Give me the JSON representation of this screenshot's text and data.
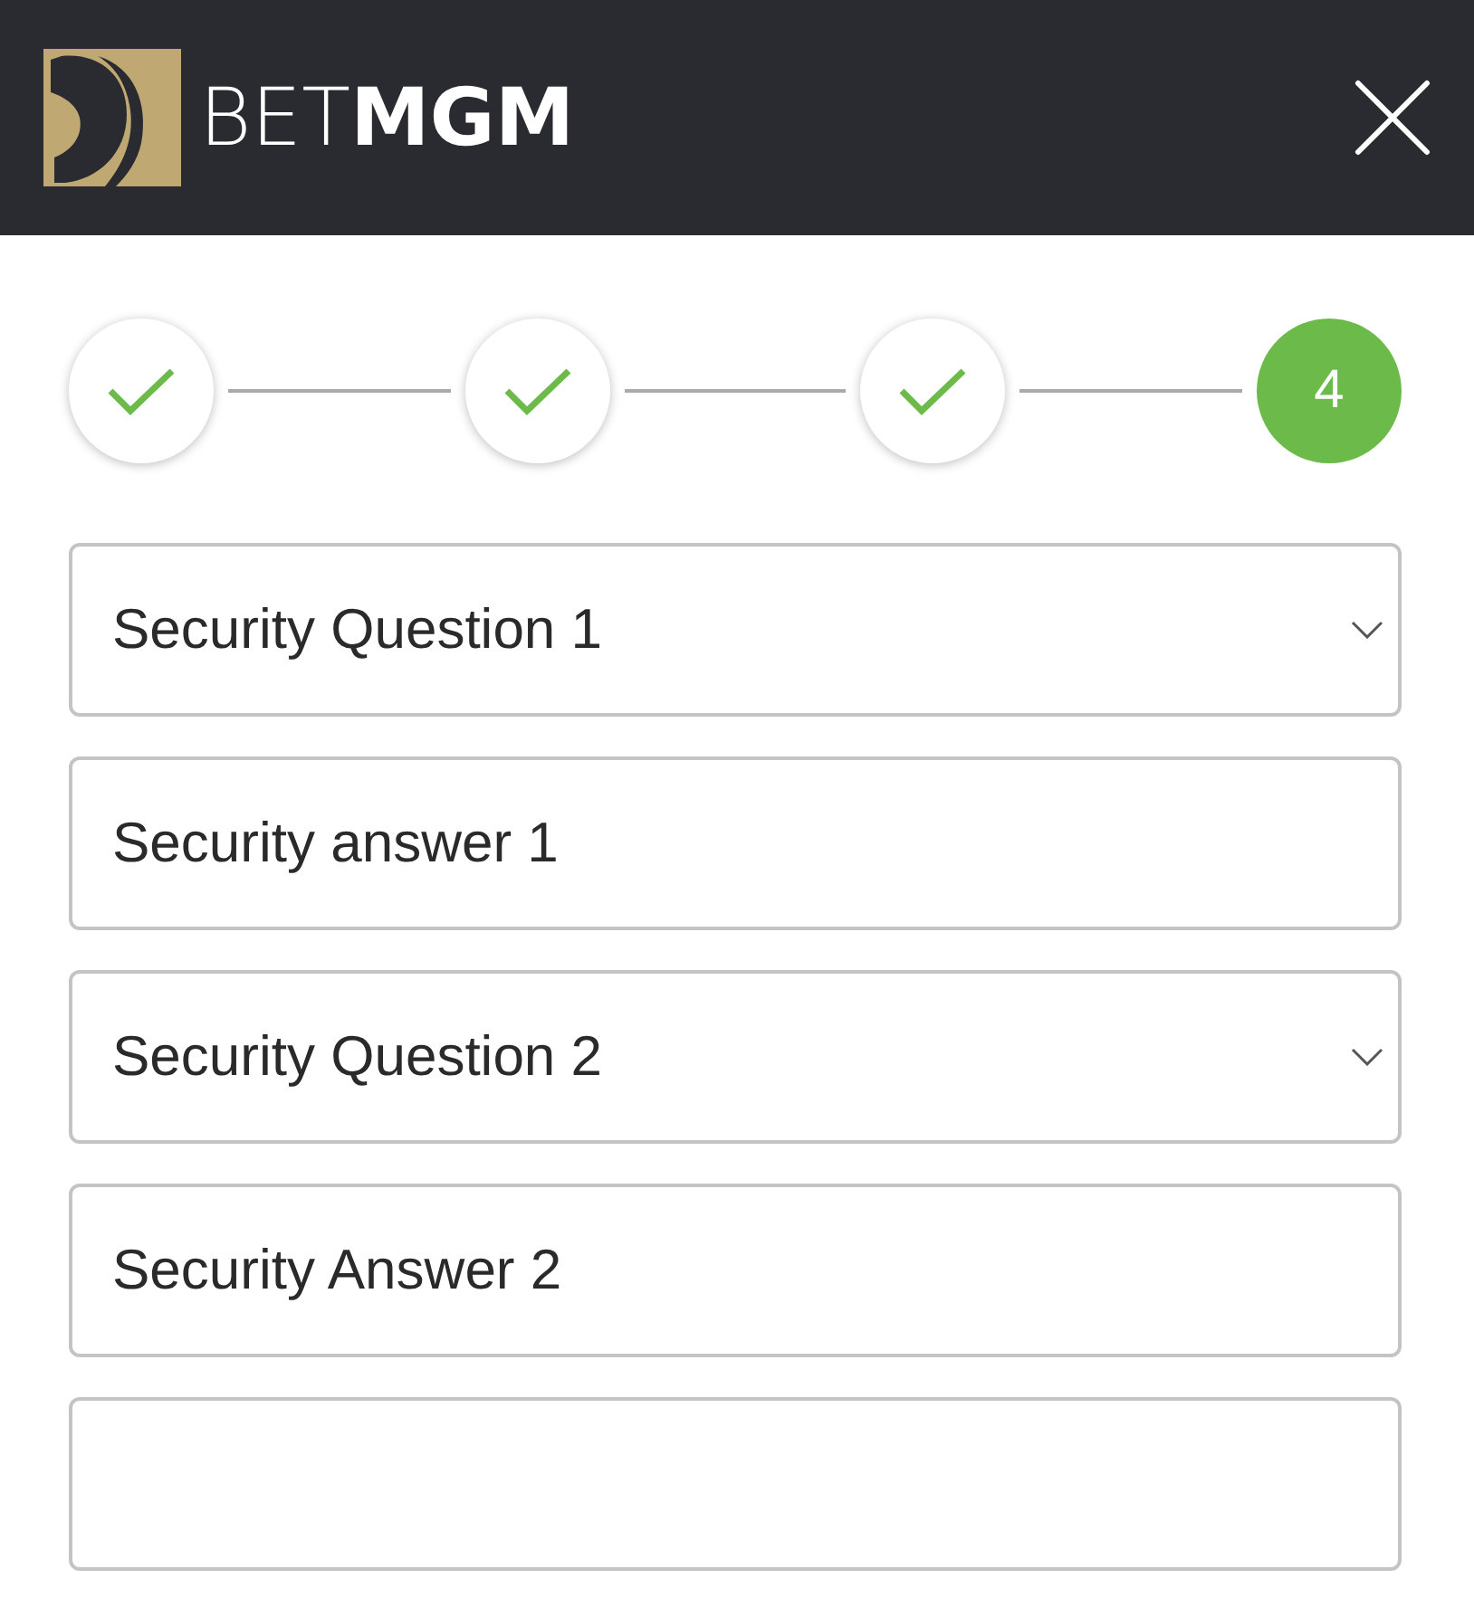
{
  "header": {
    "brand_light": "BET",
    "brand_bold": "MGM"
  },
  "steps": [
    {
      "done": true,
      "selected": false
    },
    {
      "done": true,
      "selected": false
    },
    {
      "done": true,
      "selected": false
    },
    {
      "label": "4",
      "done": false,
      "selected": true
    }
  ],
  "fields": [
    {
      "kind": "dropdown",
      "placeholder": "Security Question 1"
    },
    {
      "kind": "text",
      "placeholder": "Security answer 1"
    },
    {
      "kind": "dropdown",
      "placeholder": "Security Question 2"
    },
    {
      "kind": "text",
      "placeholder": "Security Answer 2"
    },
    {
      "kind": "text"
    }
  ]
}
